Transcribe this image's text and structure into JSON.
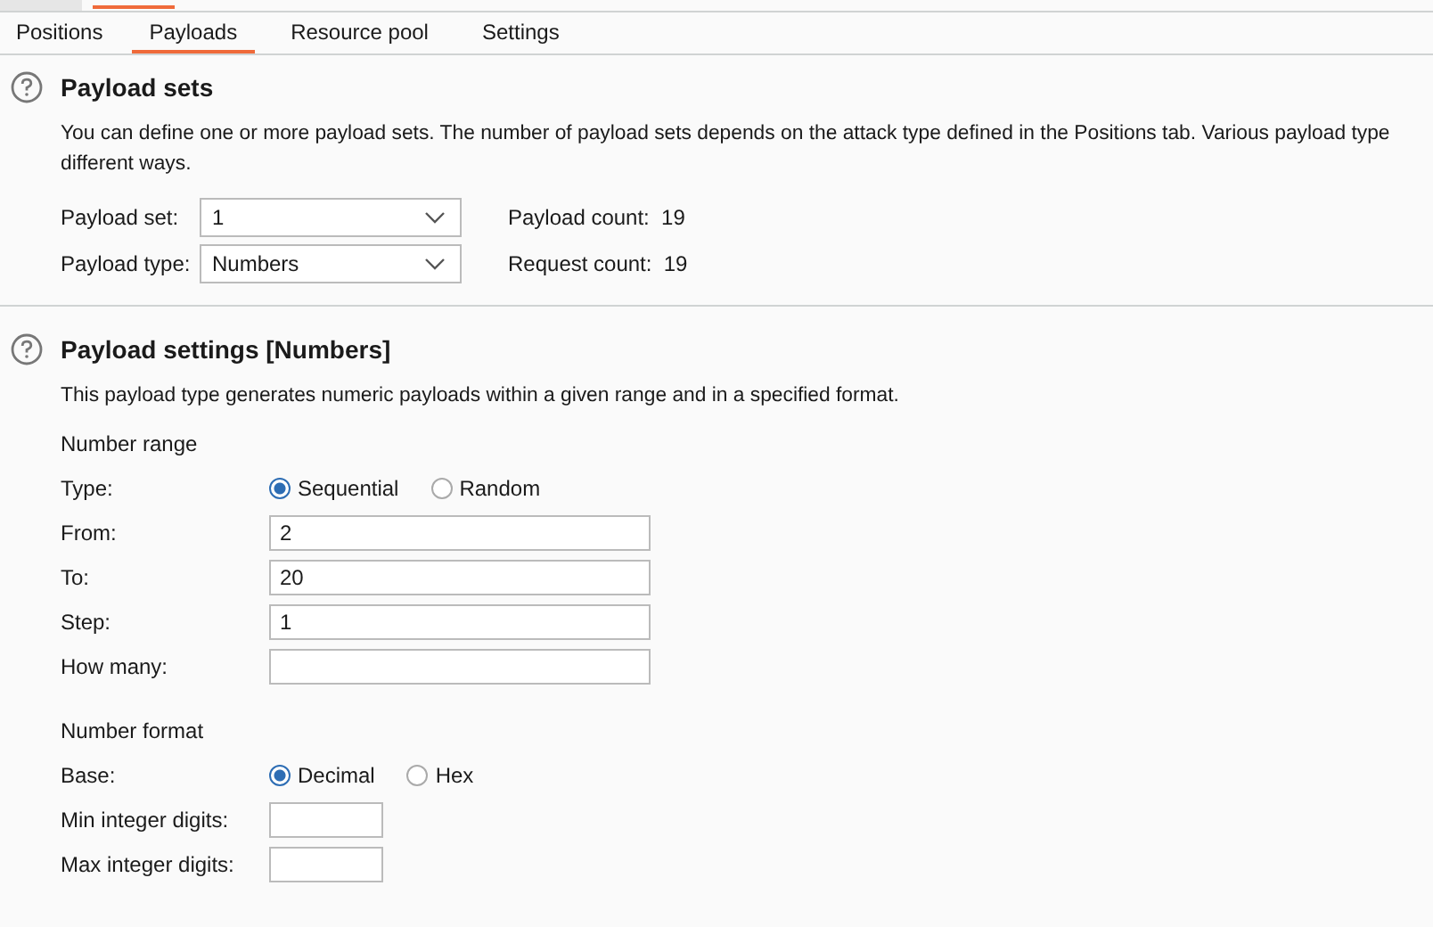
{
  "tabs": [
    {
      "label": "Positions",
      "selected": false
    },
    {
      "label": "Payloads",
      "selected": true
    },
    {
      "label": "Resource pool",
      "selected": false
    },
    {
      "label": "Settings",
      "selected": false
    }
  ],
  "payload_sets": {
    "title": "Payload sets",
    "description": [
      "You can define one or more payload sets. The number of payload sets depends on the attack type defined in the Positions tab. Various payload type",
      "different ways."
    ],
    "fields": [
      {
        "label": "Payload set:",
        "value": "1",
        "count_label": "Payload count:",
        "count": "19"
      },
      {
        "label": "Payload type:",
        "value": "Numbers",
        "count_label": "Request count:",
        "count": "19"
      }
    ]
  },
  "payload_settings": {
    "title": "Payload settings [Numbers]",
    "description": "This payload type generates numeric payloads within a given range and in a specified format.",
    "groups": [
      {
        "heading": "Number range",
        "rows": [
          {
            "kind": "radio",
            "label": "Type:",
            "options": [
              {
                "label": "Sequential",
                "selected": true
              },
              {
                "label": "Random",
                "selected": false
              }
            ]
          },
          {
            "kind": "text",
            "label": "From:",
            "value": "2"
          },
          {
            "kind": "text",
            "label": "To:",
            "value": "20"
          },
          {
            "kind": "text",
            "label": "Step:",
            "value": "1"
          },
          {
            "kind": "text",
            "label": "How many:"
          }
        ]
      },
      {
        "heading": "Number format",
        "rows": [
          {
            "kind": "radio",
            "label": "Base:",
            "options": [
              {
                "label": "Decimal",
                "selected": true
              },
              {
                "label": "Hex",
                "selected": false
              }
            ]
          },
          {
            "kind": "short_text",
            "label": "Min integer digits:"
          },
          {
            "kind": "short_text",
            "label": "Max integer digits:"
          }
        ]
      }
    ]
  }
}
